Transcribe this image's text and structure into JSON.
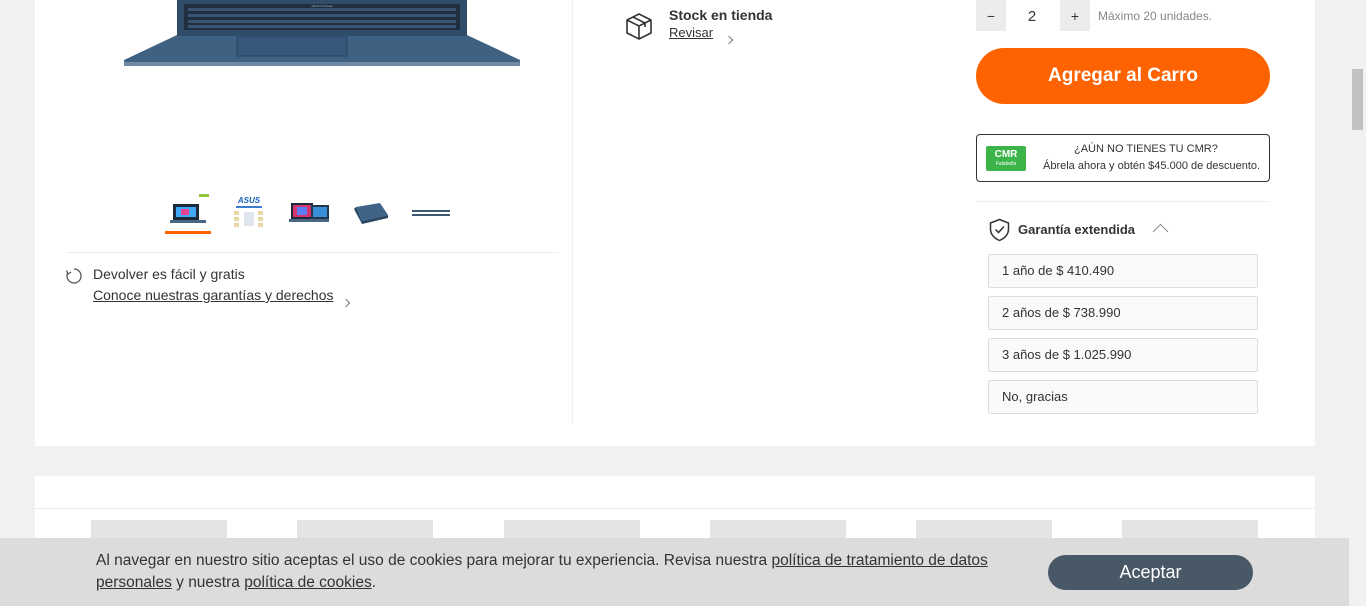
{
  "product": {
    "returns_title": "Devolver es fácil y gratis",
    "returns_link": "Conoce nuestras garantías y derechos",
    "thumbnails": [
      "Imagen 1",
      "Imagen 2",
      "Imagen 3",
      "Imagen 4",
      "Imagen 5"
    ],
    "laptop_brand_text": "ASUS Vivobook"
  },
  "stock": {
    "title": "Stock en tienda",
    "link": "Revisar"
  },
  "quantity": {
    "minus": "−",
    "value": "2",
    "plus": "+",
    "max_text": "Máximo 20 unidades."
  },
  "cart": {
    "label": "Agregar al Carro"
  },
  "cmr": {
    "logo_main": "CMR",
    "logo_sub": "Falabella",
    "title": "¿AÚN NO TIENES TU CMR?",
    "subtitle": "Ábrela ahora y obtén $45.000 de descuento."
  },
  "warranty": {
    "title": "Garantía extendida",
    "options": [
      "1 año de $ 410.490",
      "2 años de $ 738.990",
      "3 años de $ 1.025.990",
      "No, gracias"
    ]
  },
  "cookies": {
    "text_1": "Al navegar en nuestro sitio aceptas el uso de cookies para mejorar tu experiencia. Revisa nuestra ",
    "link_1": "política de tratamiento de datos personales",
    "text_2": " y nuestra ",
    "link_2": "política de cookies",
    "text_3": ".",
    "accept": "Aceptar"
  },
  "colors": {
    "accent": "#ff6200",
    "cmr_green": "#3db44a",
    "cookie_button": "#495867"
  }
}
